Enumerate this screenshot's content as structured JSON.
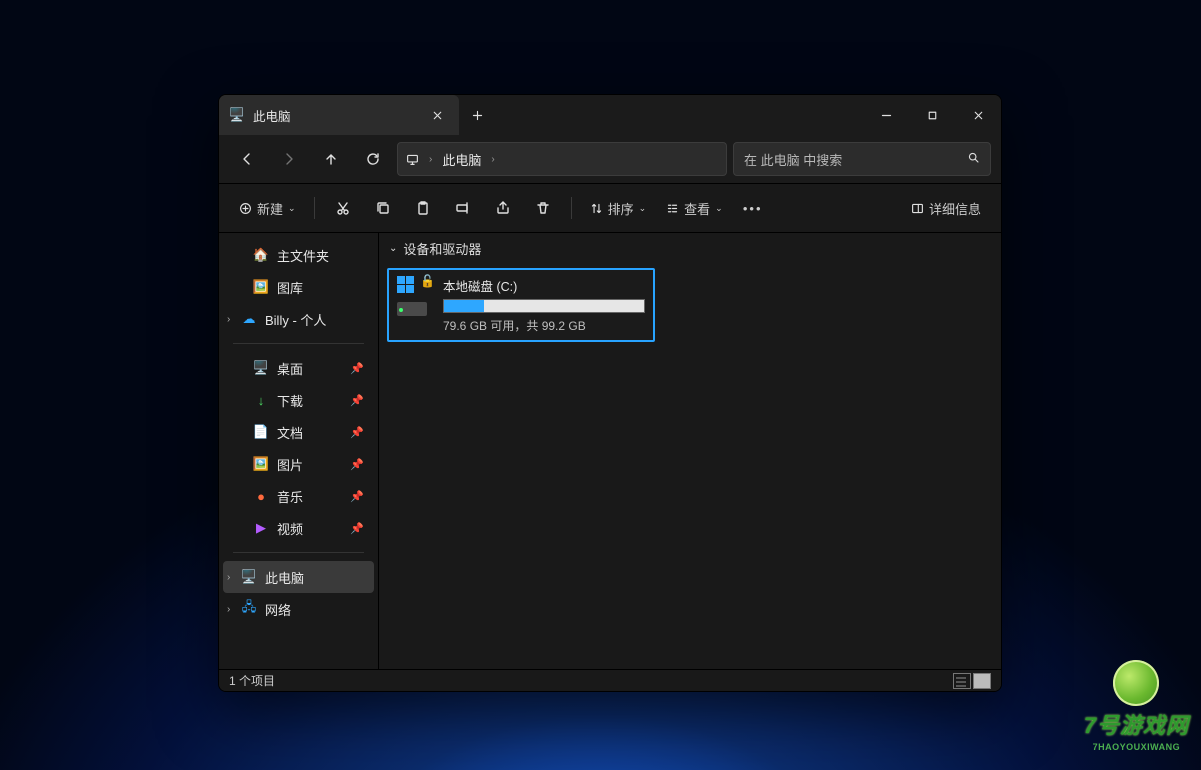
{
  "tab": {
    "title": "此电脑"
  },
  "addr": {
    "location": "此电脑"
  },
  "search": {
    "placeholder": "在 此电脑 中搜索"
  },
  "toolbar": {
    "new": "新建",
    "sort": "排序",
    "view": "查看",
    "details": "详细信息"
  },
  "sidebar": {
    "home": "主文件夹",
    "gallery": "图库",
    "onedrive": "Billy - 个人",
    "quick": [
      {
        "label": "桌面",
        "icon": "🖥️",
        "color": "#35b6ff"
      },
      {
        "label": "下载",
        "icon": "↓",
        "color": "#4cd964"
      },
      {
        "label": "文档",
        "icon": "📄",
        "color": "#d0d0d0"
      },
      {
        "label": "图片",
        "icon": "🖼️",
        "color": "#35b6ff"
      },
      {
        "label": "音乐",
        "icon": "●",
        "color": "#ff6a3d"
      },
      {
        "label": "视频",
        "icon": "▶",
        "color": "#b45cff"
      }
    ],
    "thispc": "此电脑",
    "network": "网络"
  },
  "group": {
    "header": "设备和驱动器"
  },
  "drive": {
    "name": "本地磁盘 (C:)",
    "sub": "79.6 GB 可用，共 99.2 GB",
    "fill_pct": 20
  },
  "status": {
    "text": "1 个项目"
  },
  "watermark": {
    "title": "7号游戏网",
    "sub": "7HAOYOUXIWANG"
  }
}
